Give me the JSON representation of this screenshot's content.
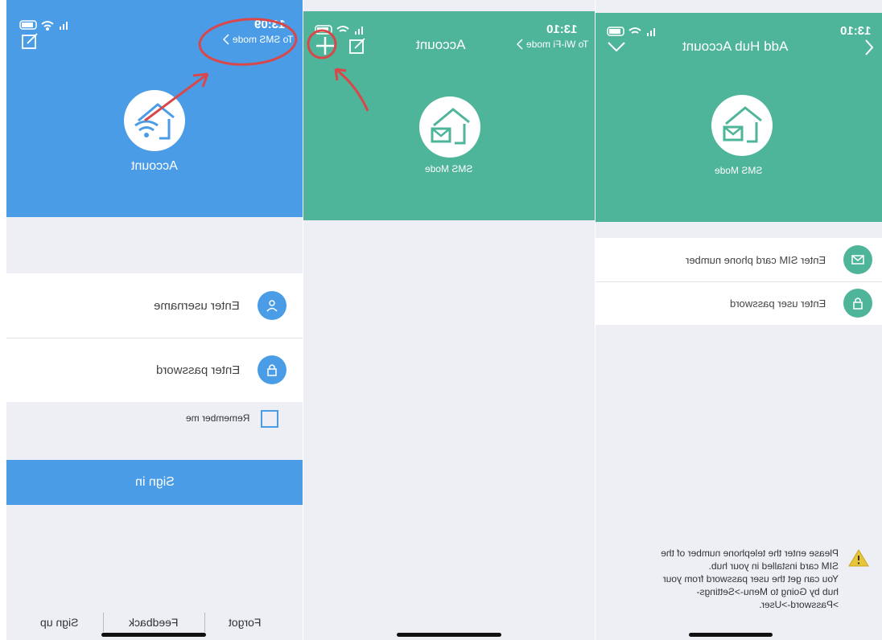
{
  "screen1": {
    "status_time": "13:09",
    "header_link": "To SMS mode",
    "account_label": "Account",
    "username_placeholder": "Enter username",
    "password_placeholder": "Enter password",
    "remember_label": "Remember me",
    "signin_label": "Sign in",
    "footer": [
      "Forgot",
      "Feedback",
      "Sign up"
    ]
  },
  "screen2": {
    "status_time": "13:10",
    "header_link": "To Wi-Fi mode",
    "title": "Account",
    "mode_label": "SMS Mode"
  },
  "screen3": {
    "status_time": "13:10",
    "title": "Add Hub Account",
    "mode_label": "SMS Mode",
    "phone_placeholder": "Enter SIM card phone number",
    "password_placeholder": "Enter user password",
    "hint_lines": [
      "Please enter the telephone number of the",
      "SIM card installed in your hub.",
      "You can get the user password from your",
      "hub by Going to Menu->Settings-",
      ">Password->User."
    ]
  },
  "colors": {
    "blue": "#4a9ce6",
    "green": "#4fb59a",
    "annotation_red": "#d9474a",
    "bg_light": "#edeff5"
  },
  "icons": [
    "battery-icon",
    "wifi-icon",
    "signal-icon",
    "edit-icon",
    "chevron-left-icon",
    "plus-icon",
    "house-wifi-icon",
    "house-mail-icon",
    "user-icon",
    "lock-icon",
    "mail-icon",
    "checkbox-icon",
    "warning-icon",
    "chevron-down-icon"
  ]
}
